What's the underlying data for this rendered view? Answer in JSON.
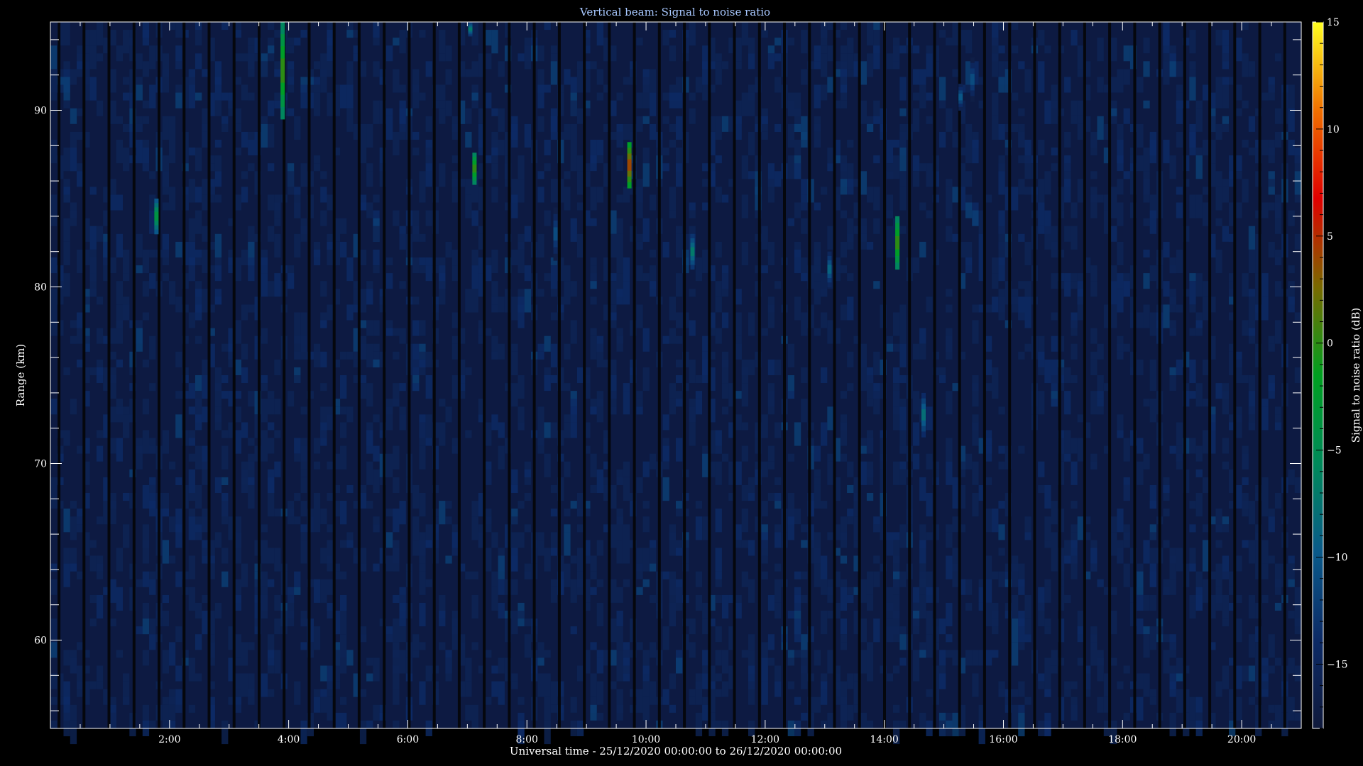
{
  "chart_data": {
    "type": "heatmap",
    "title": "Vertical beam: Signal to noise ratio",
    "xlabel": "Universal time - 25/12/2020 00:00:00 to 26/12/2020 00:00:00",
    "ylabel": "Range (km)",
    "colorbar_label": "Signal to noise ratio (dB)",
    "x_unit": "hours UT",
    "xlim": [
      0,
      21
    ],
    "ylim": [
      55,
      95
    ],
    "x_ticks": [
      2,
      4,
      6,
      8,
      10,
      12,
      14,
      16,
      18,
      20
    ],
    "x_tick_labels": [
      "2:00",
      "4:00",
      "6:00",
      "8:00",
      "10:00",
      "12:00",
      "14:00",
      "16:00",
      "18:00",
      "20:00"
    ],
    "y_ticks": [
      60,
      70,
      80,
      90
    ],
    "y_tick_labels": [
      "60",
      "70",
      "80",
      "90"
    ],
    "clim": [
      -18,
      15
    ],
    "cbar_ticks": [
      -15,
      -10,
      -5,
      0,
      5,
      10,
      15
    ],
    "cbar_tick_labels": [
      "−15",
      "−10",
      "−5",
      "0",
      "5",
      "10",
      "15"
    ],
    "background_snr_db": -16,
    "colormap": [
      "#101a3c",
      "#0c2a66",
      "#0a5a8a",
      "#008a5a",
      "#00a020",
      "#7a6a00",
      "#e00000",
      "#f07000",
      "#ffff20"
    ],
    "echoes": [
      {
        "time": 1.78,
        "range_bottom": 83.0,
        "range_top": 85.0,
        "peak_snr": -3
      },
      {
        "time": 3.9,
        "range_bottom": 89.5,
        "range_top": 95.0,
        "peak_snr": 1
      },
      {
        "time": 7.05,
        "range_bottom": 94.2,
        "range_top": 95.0,
        "peak_snr": -6
      },
      {
        "time": 7.12,
        "range_bottom": 85.8,
        "range_top": 87.6,
        "peak_snr": 1
      },
      {
        "time": 8.48,
        "range_bottom": 81.5,
        "range_top": 84.5,
        "peak_snr": -10
      },
      {
        "time": 9.72,
        "range_bottom": 85.6,
        "range_top": 88.2,
        "peak_snr": 5
      },
      {
        "time": 10.78,
        "range_bottom": 81.0,
        "range_top": 83.0,
        "peak_snr": -6
      },
      {
        "time": 13.08,
        "range_bottom": 80.0,
        "range_top": 82.0,
        "peak_snr": -8
      },
      {
        "time": 14.22,
        "range_bottom": 81.0,
        "range_top": 84.0,
        "peak_snr": 1
      },
      {
        "time": 14.66,
        "range_bottom": 71.5,
        "range_top": 74.0,
        "peak_snr": -7
      },
      {
        "time": 15.28,
        "range_bottom": 90.0,
        "range_top": 91.5,
        "peak_snr": -9
      },
      {
        "time": 15.48,
        "range_bottom": 90.5,
        "range_top": 93.0,
        "peak_snr": -10
      }
    ]
  }
}
